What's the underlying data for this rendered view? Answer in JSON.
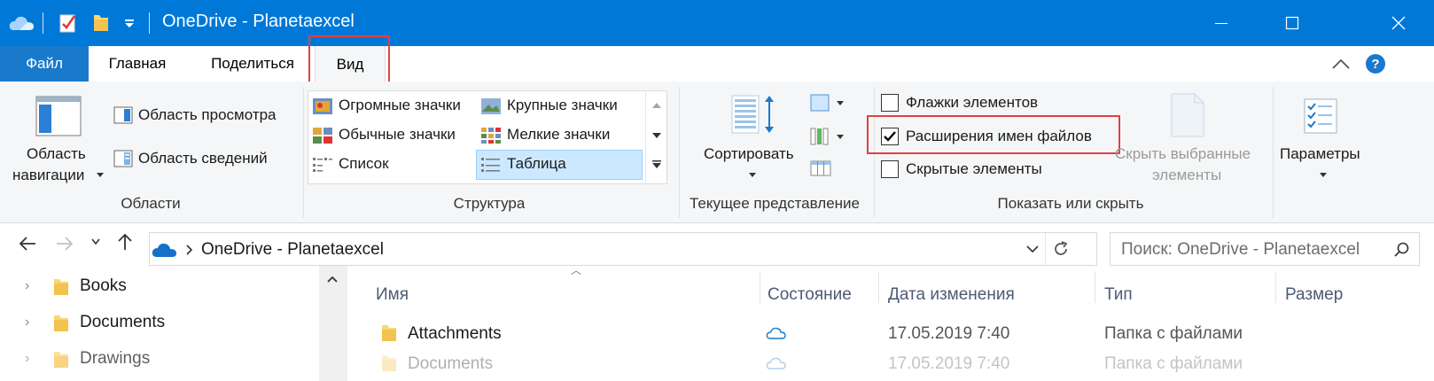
{
  "window": {
    "title": "OneDrive - Planetaexcel",
    "accent": "#0078d7"
  },
  "ribbon_tabs": [
    "Файл",
    "Главная",
    "Поделиться",
    "Вид"
  ],
  "ribbon": {
    "panes": {
      "nav_pane": [
        "Область",
        "навигации"
      ],
      "preview_pane": "Область просмотра",
      "details_pane": "Область сведений",
      "group_label": "Области"
    },
    "layout": {
      "items": [
        "Огромные значки",
        "Крупные значки",
        "Обычные значки",
        "Мелкие значки",
        "Список",
        "Таблица"
      ],
      "selected": "Таблица",
      "group_label": "Структура"
    },
    "current_view": {
      "sort": "Сортировать",
      "group_label": "Текущее представление"
    },
    "show_hide": {
      "item_checkboxes": {
        "label": "Флажки элементов",
        "checked": false
      },
      "file_extensions": {
        "label": "Расширения имен файлов",
        "checked": true
      },
      "hidden_items": {
        "label": "Скрытые элементы",
        "checked": false
      },
      "hide_selected": [
        "Скрыть выбранные",
        "элементы"
      ],
      "group_label": "Показать или скрыть"
    },
    "options": "Параметры"
  },
  "address_bar": {
    "path": "OneDrive - Planetaexcel",
    "search_placeholder": "Поиск: OneDrive - Planetaexcel"
  },
  "navigation_pane": [
    "Books",
    "Documents",
    "Drawings"
  ],
  "file_list": {
    "columns": [
      "Имя",
      "Состояние",
      "Дата изменения",
      "Тип",
      "Размер"
    ],
    "rows": [
      {
        "name": "Attachments",
        "status": "cloud-icon",
        "date": "17.05.2019 7:40",
        "type": "Папка с файлами"
      },
      {
        "name": "Documents",
        "status": "cloud-icon",
        "date": "17.05.2019 7:40",
        "type": "Папка с файлами"
      }
    ]
  },
  "colors": {
    "highlight": "#e04141",
    "selection": "#cce8ff",
    "folder": "#f8d775"
  }
}
